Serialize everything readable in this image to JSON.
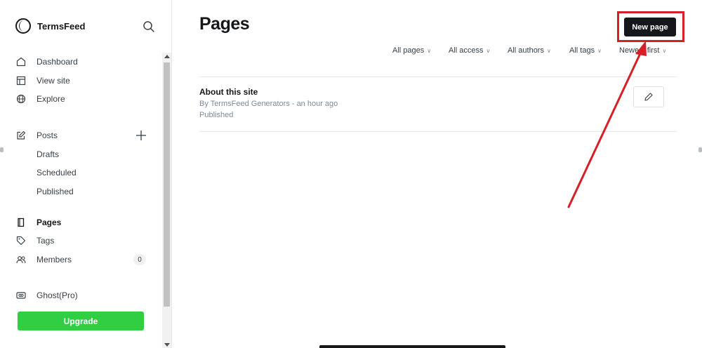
{
  "sidebar": {
    "brand_name": "TermsFeed",
    "nav": [
      {
        "label": "Dashboard",
        "icon": "home-icon"
      },
      {
        "label": "View site",
        "icon": "layout-icon"
      },
      {
        "label": "Explore",
        "icon": "globe-icon"
      }
    ],
    "posts": {
      "label": "Posts",
      "icon": "edit-icon",
      "sub": [
        "Drafts",
        "Scheduled",
        "Published"
      ]
    },
    "pages": {
      "label": "Pages",
      "icon": "page-icon"
    },
    "tags": {
      "label": "Tags",
      "icon": "tag-icon"
    },
    "members": {
      "label": "Members",
      "icon": "members-icon",
      "count": "0"
    },
    "ghost_pro": {
      "label": "Ghost(Pro)",
      "icon": "ghost-pro-icon"
    },
    "upgrade_label": "Upgrade"
  },
  "main": {
    "title": "Pages",
    "new_page_label": "New page",
    "filters": [
      "All pages",
      "All access",
      "All authors",
      "All tags",
      "Newest first"
    ],
    "items": [
      {
        "title": "About this site",
        "meta": "By TermsFeed Generators - an hour ago",
        "status": "Published"
      }
    ]
  },
  "colors": {
    "accent_dark": "#15171a",
    "upgrade_green": "#30cf43",
    "highlight_red": "#d61f26",
    "muted_text": "#7c8b9a"
  }
}
